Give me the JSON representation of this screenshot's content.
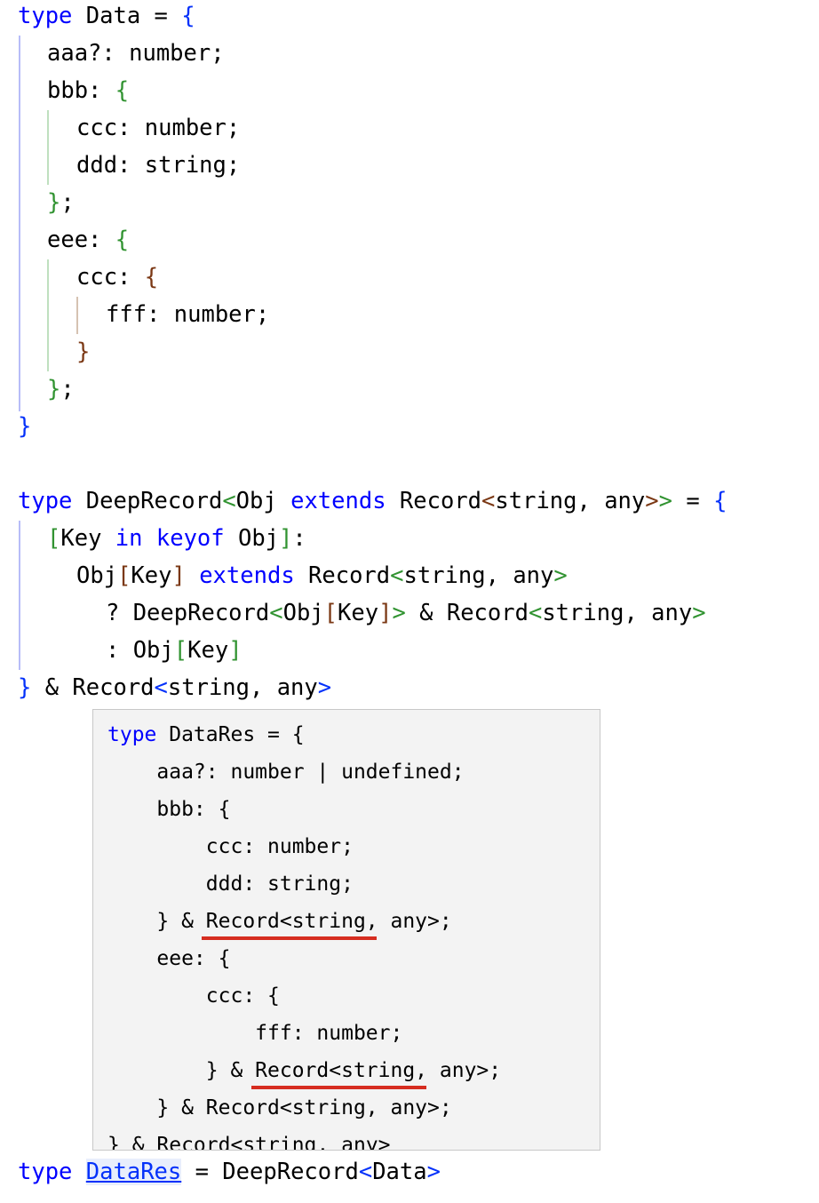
{
  "editor": {
    "language": "typescript",
    "background_color": "#ffffff",
    "foreground_color": "#000000",
    "keyword_color": "#0000ff",
    "bracket_level_colors": [
      "#0431fa",
      "#319331",
      "#7b3814"
    ],
    "lines": [
      {
        "indent": 0,
        "text": "type Data = {"
      },
      {
        "indent": 1,
        "text": "aaa?: number;"
      },
      {
        "indent": 1,
        "text": "bbb: {"
      },
      {
        "indent": 2,
        "text": "ccc: number;"
      },
      {
        "indent": 2,
        "text": "ddd: string;"
      },
      {
        "indent": 1,
        "text": "};"
      },
      {
        "indent": 1,
        "text": "eee: {"
      },
      {
        "indent": 2,
        "text": "ccc: {"
      },
      {
        "indent": 3,
        "text": "fff: number;"
      },
      {
        "indent": 2,
        "text": "}"
      },
      {
        "indent": 1,
        "text": "};"
      },
      {
        "indent": 0,
        "text": "}"
      },
      {
        "indent": 0,
        "text": ""
      },
      {
        "indent": 0,
        "text": "type DeepRecord<Obj extends Record<string, any>> = {"
      },
      {
        "indent": 1,
        "text": "[Key in keyof Obj]:"
      },
      {
        "indent": 2,
        "text": "Obj[Key] extends Record<string, any>"
      },
      {
        "indent": 3,
        "text": "? DeepRecord<Obj[Key]> & Record<string, any>"
      },
      {
        "indent": 3,
        "text": ": Obj[Key]"
      },
      {
        "indent": 0,
        "text": "} & Record<string, any>"
      },
      {
        "indent": 0,
        "text": "type DataRes = DeepRecord<Data>"
      }
    ],
    "keywords": [
      "type",
      "extends",
      "in",
      "keyof"
    ],
    "hover_link": {
      "text": "DataRes",
      "color": "#0431fa",
      "highlight_color": "#e8eefc",
      "underlined": true
    },
    "indent_guides": [
      {
        "level": 0,
        "color": "#b7bdf8"
      },
      {
        "level": 1,
        "color": "#bfe0bf"
      },
      {
        "level": 2,
        "color": "#d6c2b2"
      }
    ]
  },
  "tooltip": {
    "background_color": "#f3f3f3",
    "border_color": "#c8c8c8",
    "error_underline_color": "#d62d20",
    "keyword": "type",
    "lines": [
      {
        "text": "type DataRes = {",
        "error": false
      },
      {
        "text": "    aaa?: number | undefined;",
        "error": false
      },
      {
        "text": "    bbb: {",
        "error": false
      },
      {
        "text": "        ccc: number;",
        "error": false
      },
      {
        "text": "        ddd: string;",
        "error": false
      },
      {
        "text": "    } & Record<string, any>;",
        "error": true
      },
      {
        "text": "    eee: {",
        "error": false
      },
      {
        "text": "        ccc: {",
        "error": false
      },
      {
        "text": "            fff: number;",
        "error": false
      },
      {
        "text": "        } & Record<string, any>;",
        "error": true
      },
      {
        "text": "    } & Record<string, any>;",
        "error": false
      },
      {
        "text": "} & Record<string, any>",
        "error": false
      }
    ]
  }
}
